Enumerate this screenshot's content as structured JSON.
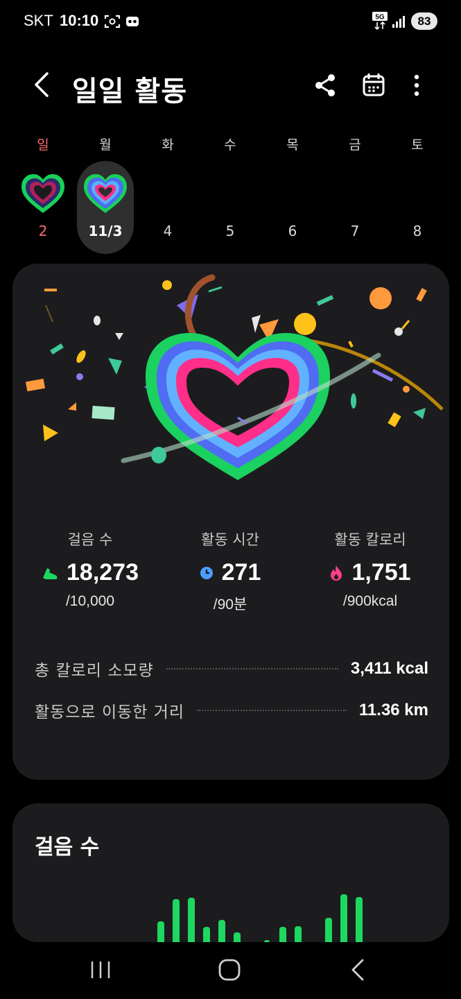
{
  "status_bar": {
    "carrier": "SKT",
    "time": "10:10",
    "network": "5G",
    "battery": "83"
  },
  "header": {
    "title": "일일 활동"
  },
  "week": {
    "days": [
      "일",
      "월",
      "화",
      "수",
      "목",
      "금",
      "토"
    ],
    "dates": [
      "2",
      "11/3",
      "4",
      "5",
      "6",
      "7",
      "8"
    ],
    "selected_index": 1
  },
  "summary": {
    "steps": {
      "label": "걸음 수",
      "value": "18,273",
      "goal": "/10,000",
      "icon": "shoe-icon"
    },
    "active_time": {
      "label": "활동 시간",
      "value": "271",
      "goal": "/90분",
      "icon": "clock-icon"
    },
    "active_calories": {
      "label": "활동 칼로리",
      "value": "1,751",
      "goal": "/900kcal",
      "icon": "flame-icon"
    },
    "total_calories": {
      "label": "총 칼로리 소모량",
      "value": "3,411 kcal"
    },
    "distance": {
      "label": "활동으로 이동한 거리",
      "value": "11.36 km"
    }
  },
  "steps_card": {
    "title": "걸음 수"
  },
  "colors": {
    "steps_green": "#1ed760",
    "time_blue": "#4a9eff",
    "calories_pink": "#ff3d8b",
    "card_bg": "#1c1c1e"
  }
}
